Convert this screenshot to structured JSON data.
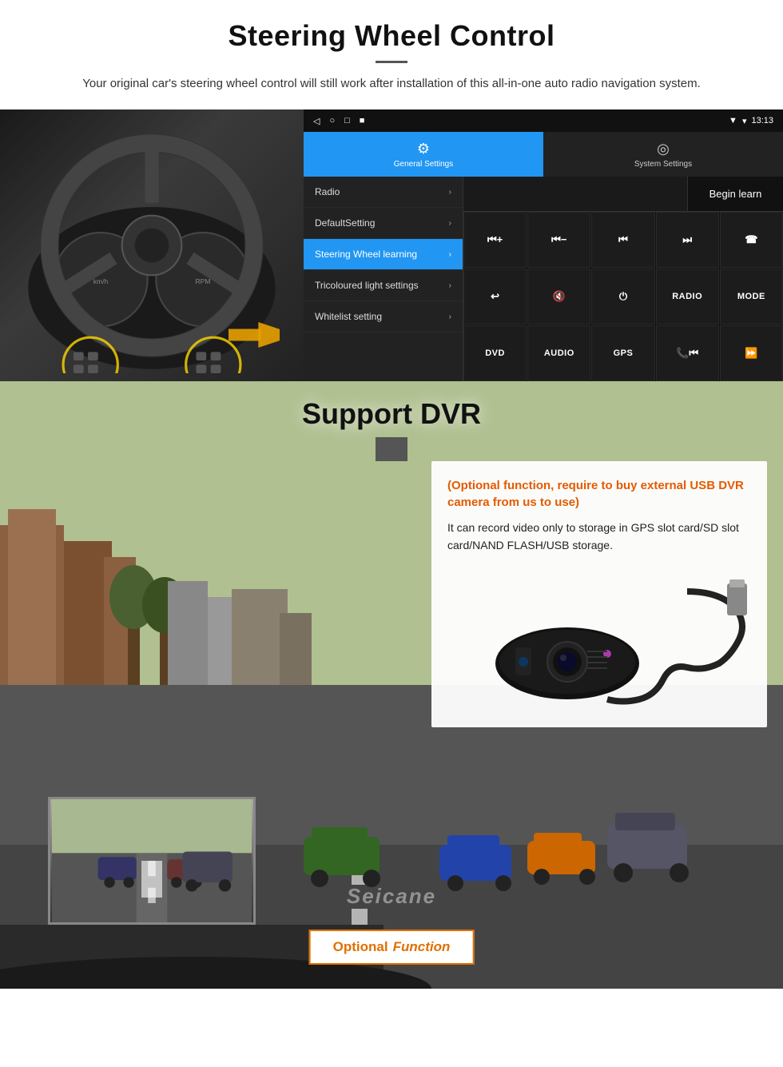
{
  "steering_section": {
    "title": "Steering Wheel Control",
    "subtitle": "Your original car's steering wheel control will still work after installation of this all-in-one auto radio navigation system.",
    "status_bar": {
      "time": "13:13",
      "nav_icons": "◁  ○  □  ■"
    },
    "nav_tabs": [
      {
        "icon": "⚙",
        "label": "General Settings",
        "active": true
      },
      {
        "icon": "◎",
        "label": "System Settings",
        "active": false
      }
    ],
    "menu_items": [
      {
        "label": "Radio",
        "active": false
      },
      {
        "label": "DefaultSetting",
        "active": false
      },
      {
        "label": "Steering Wheel learning",
        "active": true
      },
      {
        "label": "Tricoloured light settings",
        "active": false
      },
      {
        "label": "Whitelist setting",
        "active": false
      }
    ],
    "begin_learn_label": "Begin learn",
    "control_buttons": [
      "⏮+",
      "⏮-",
      "⏮",
      "⏭",
      "☎",
      "↩",
      "🔇×",
      "⏻",
      "RADIO",
      "MODE",
      "DVD",
      "AUDIO",
      "GPS",
      "📞⏮",
      "⏩⏭"
    ]
  },
  "dvr_section": {
    "title": "Support DVR",
    "optional_title": "(Optional function, require to buy external USB DVR camera from us to use)",
    "description": "It can record video only to storage in GPS slot card/SD slot card/NAND FLASH/USB storage.",
    "optional_function_label_opt": "Optional",
    "optional_function_label_fn": "Function",
    "seicane_watermark": "Seicane"
  }
}
